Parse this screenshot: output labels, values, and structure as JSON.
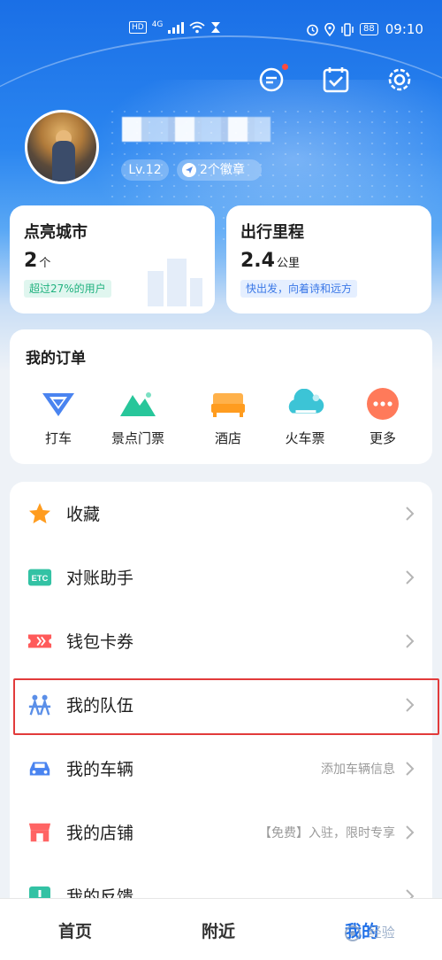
{
  "status_bar": {
    "network": "HD",
    "signal_label": "4G",
    "battery": "88",
    "time": "09:10"
  },
  "profile": {
    "level": "Lv.12",
    "badges": "2个徽章"
  },
  "stats": [
    {
      "title": "点亮城市",
      "value": "2",
      "unit": "个",
      "tag": "超过27%的用户"
    },
    {
      "title": "出行里程",
      "value": "2.4",
      "unit": "公里",
      "tag": "快出发，向着诗和远方"
    }
  ],
  "orders": {
    "title": "我的订单",
    "items": [
      {
        "label": "打车",
        "icon": "taxi-icon"
      },
      {
        "label": "景点门票",
        "icon": "mountain-icon"
      },
      {
        "label": "酒店",
        "icon": "bed-icon"
      },
      {
        "label": "火车票",
        "icon": "cloud-train-icon"
      },
      {
        "label": "更多",
        "icon": "more-icon"
      }
    ]
  },
  "menu": [
    {
      "label": "收藏",
      "hint": "",
      "icon": "star-icon"
    },
    {
      "label": "对账助手",
      "hint": "",
      "icon": "etc-icon"
    },
    {
      "label": "钱包卡券",
      "hint": "",
      "icon": "ticket-icon"
    },
    {
      "label": "我的队伍",
      "hint": "",
      "icon": "team-icon"
    },
    {
      "label": "我的车辆",
      "hint": "添加车辆信息",
      "icon": "car-icon"
    },
    {
      "label": "我的店铺",
      "hint": "【免费】入驻，限时专享",
      "icon": "shop-icon"
    },
    {
      "label": "我的反馈",
      "hint": "",
      "icon": "feedback-icon"
    }
  ],
  "nav": {
    "home": "首页",
    "nearby": "附近",
    "mine": "我的"
  },
  "watermark": "经验",
  "colors": {
    "accent": "#1e6fe8",
    "highlight": "#e23b3b"
  }
}
